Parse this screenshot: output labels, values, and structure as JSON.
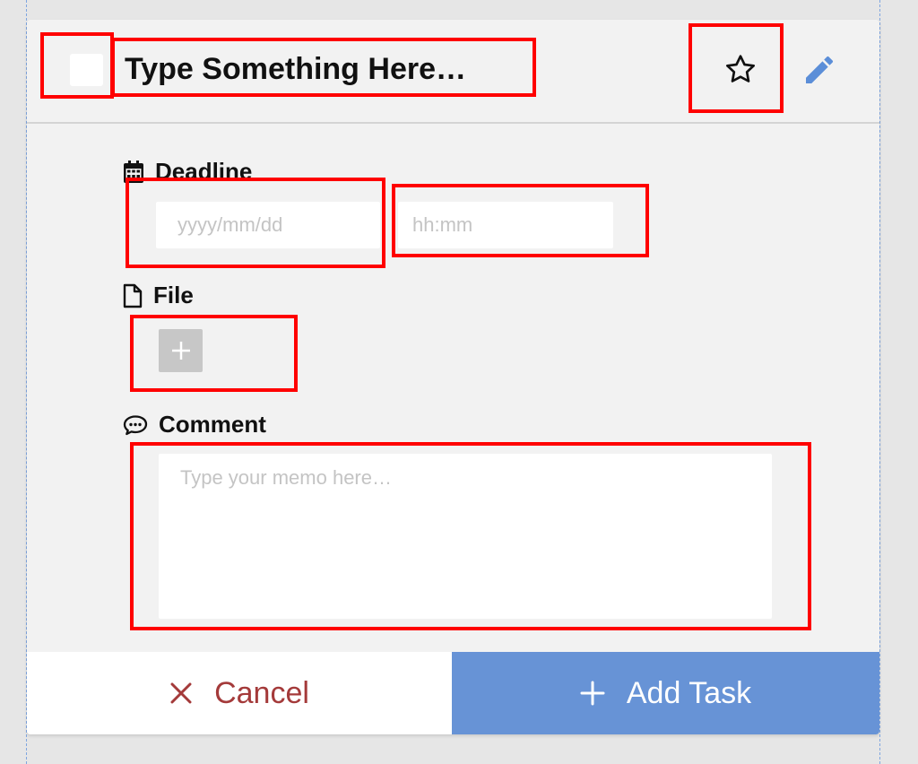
{
  "task": {
    "title": "Type Something Here…"
  },
  "deadline": {
    "label": "Deadline",
    "date_placeholder": "yyyy/mm/dd",
    "time_placeholder": "hh:mm"
  },
  "file": {
    "label": "File",
    "add_symbol": "+"
  },
  "comment": {
    "label": "Comment",
    "placeholder": "Type your memo here…"
  },
  "actions": {
    "cancel_label": "Cancel",
    "add_label": "Add Task"
  },
  "icons": {
    "star": "star-outline-icon",
    "edit": "pencil-icon",
    "deadline": "calendar-icon",
    "file": "file-icon",
    "comment": "comment-dots-icon",
    "cancel": "close-icon",
    "add": "plus-icon"
  },
  "colors": {
    "primary": "#6793d6",
    "cancel_text": "#a43a3a",
    "card_background": "#f2f2f2",
    "page_background": "#e6e6e6",
    "annotation": "#ff0000"
  }
}
